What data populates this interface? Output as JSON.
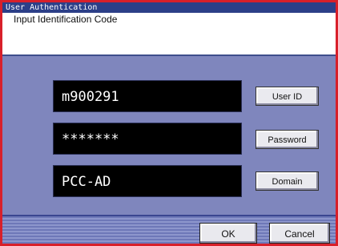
{
  "window": {
    "title": "User Authentication"
  },
  "header": {
    "instruction": "Input Identification Code"
  },
  "fields": {
    "user_id": {
      "value": "m900291",
      "button_label": "User ID"
    },
    "password": {
      "value": "*******",
      "button_label": "Password"
    },
    "domain": {
      "value": "PCC-AD",
      "button_label": "Domain"
    }
  },
  "footer": {
    "ok_label": "OK",
    "cancel_label": "Cancel"
  },
  "colors": {
    "frame": "#d8202a",
    "titlebar": "#2c3f88",
    "panel": "#7f86bd",
    "field_background": "#000000"
  }
}
